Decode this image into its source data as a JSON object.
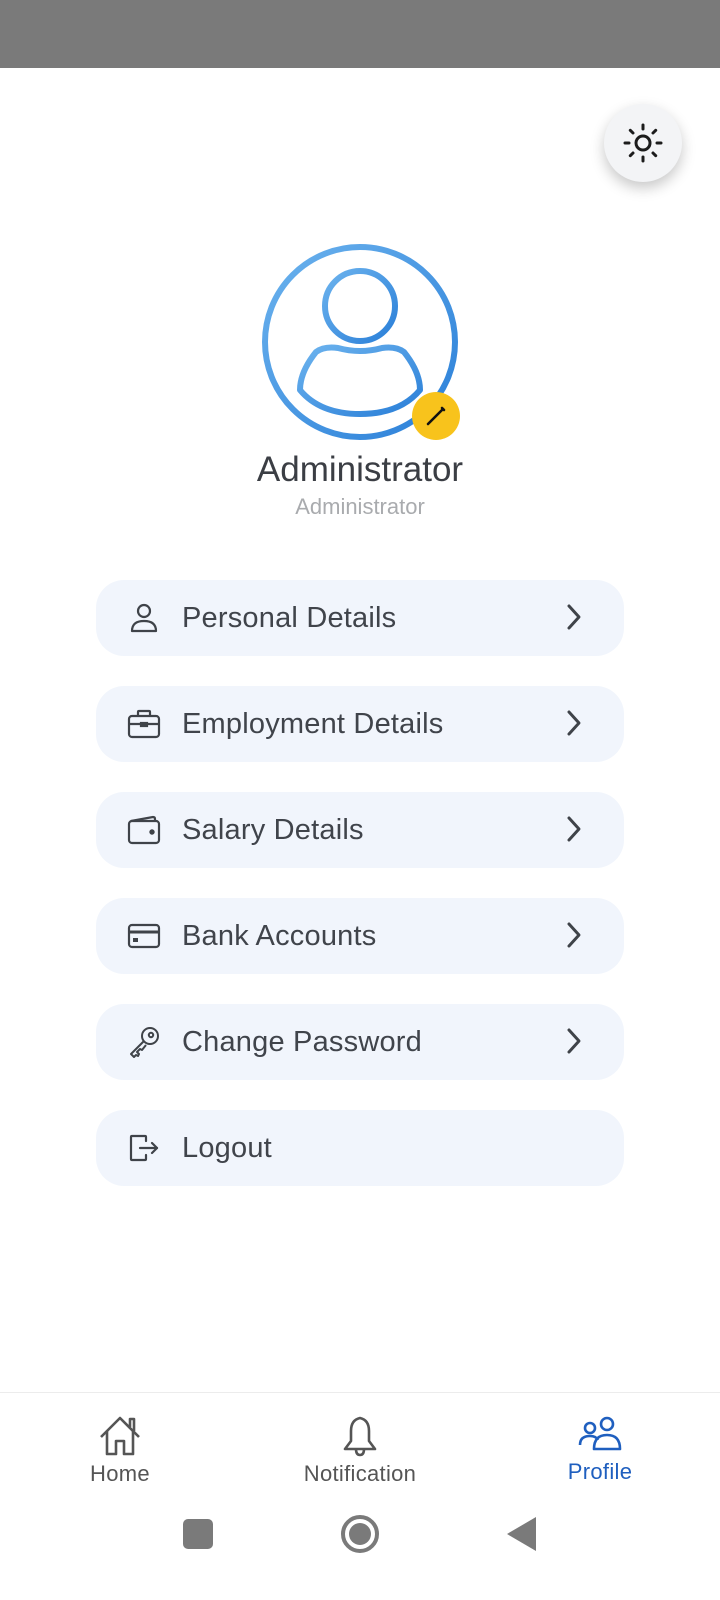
{
  "theme_toggle": {
    "icon": "sun-icon"
  },
  "profile": {
    "name": "Administrator",
    "role": "Administrator",
    "avatar_icon": "user-circle-icon",
    "edit_icon": "pencil-icon",
    "colors": {
      "avatar_blue": "#3a8fe0",
      "edit_badge": "#f8c31c"
    }
  },
  "menu": {
    "items": [
      {
        "label": "Personal Details",
        "icon": "user-icon",
        "has_chevron": true
      },
      {
        "label": "Employment Details",
        "icon": "briefcase-icon",
        "has_chevron": true
      },
      {
        "label": "Salary Details",
        "icon": "wallet-icon",
        "has_chevron": true
      },
      {
        "label": "Bank Accounts",
        "icon": "credit-card-icon",
        "has_chevron": true
      },
      {
        "label": "Change Password",
        "icon": "key-icon",
        "has_chevron": true
      },
      {
        "label": "Logout",
        "icon": "logout-icon",
        "has_chevron": false
      }
    ]
  },
  "bottom_nav": {
    "items": [
      {
        "label": "Home",
        "icon": "home-icon",
        "active": false
      },
      {
        "label": "Notification",
        "icon": "bell-icon",
        "active": false
      },
      {
        "label": "Profile",
        "icon": "users-icon",
        "active": true
      }
    ],
    "active_color": "#1f5fbf"
  },
  "system_nav": {
    "buttons": [
      "recents-button",
      "home-button",
      "back-button"
    ]
  }
}
